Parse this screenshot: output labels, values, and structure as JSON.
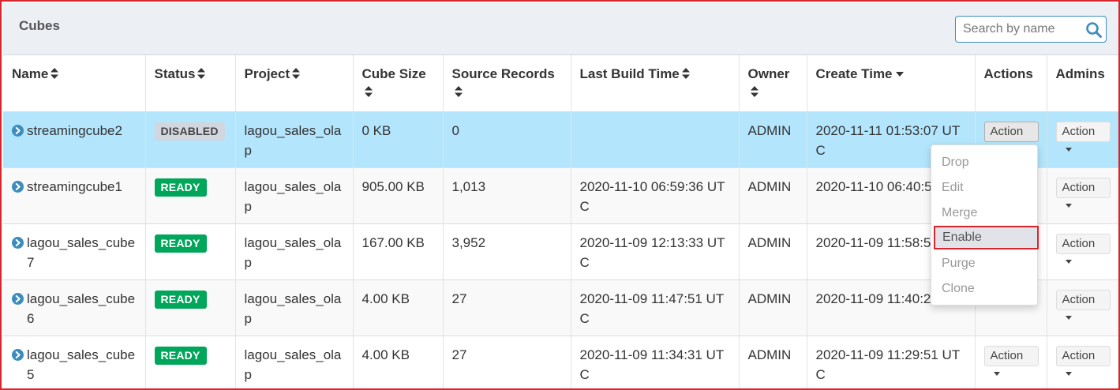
{
  "panel": {
    "title": "Cubes",
    "search_placeholder": "Search by name",
    "search_icon": "search-icon"
  },
  "colors": {
    "selected_row": "#b3e5fc",
    "ready_badge": "#00a65a",
    "disabled_badge": "#d2d6de",
    "highlight_border": "#d9262e",
    "link_icon": "#3c8dbc"
  },
  "columns": [
    {
      "label": "Name",
      "sort": "both"
    },
    {
      "label": "Status",
      "sort": "both"
    },
    {
      "label": "Project",
      "sort": "both"
    },
    {
      "label": "Cube Size",
      "sort": "both"
    },
    {
      "label": "Source Records",
      "sort": "both"
    },
    {
      "label": "Last Build Time",
      "sort": "both"
    },
    {
      "label": "Owner",
      "sort": "both"
    },
    {
      "label": "Create Time",
      "sort": "desc"
    },
    {
      "label": "Actions",
      "sort": "none"
    },
    {
      "label": "Admins",
      "sort": "none"
    }
  ],
  "rows": [
    {
      "name": "streamingcube2",
      "status": "DISABLED",
      "project": "lagou_sales_olap",
      "cube_size": "0 KB",
      "source_records": "0",
      "last_build_time": "",
      "owner": "ADMIN",
      "create_time": "2020-11-11 01:53:07 UTC",
      "action_label": "Action",
      "admin_label": "Action"
    },
    {
      "name": "streamingcube1",
      "status": "READY",
      "project": "lagou_sales_olap",
      "cube_size": "905.00 KB",
      "source_records": "1,013",
      "last_build_time": "2020-11-10 06:59:36 UTC",
      "owner": "ADMIN",
      "create_time": "2020-11-10 06:40:5",
      "action_label": "",
      "admin_label": "Action"
    },
    {
      "name": "lagou_sales_cube7",
      "status": "READY",
      "project": "lagou_sales_olap",
      "cube_size": "167.00 KB",
      "source_records": "3,952",
      "last_build_time": "2020-11-09 12:13:33 UTC",
      "owner": "ADMIN",
      "create_time": "2020-11-09 11:58:5",
      "action_label": "",
      "admin_label": "Action"
    },
    {
      "name": "lagou_sales_cube6",
      "status": "READY",
      "project": "lagou_sales_olap",
      "cube_size": "4.00 KB",
      "source_records": "27",
      "last_build_time": "2020-11-09 11:47:51 UTC",
      "owner": "ADMIN",
      "create_time": "2020-11-09 11:40:2",
      "action_label": "",
      "admin_label": "Action"
    },
    {
      "name": "lagou_sales_cube5",
      "status": "READY",
      "project": "lagou_sales_olap",
      "cube_size": "4.00 KB",
      "source_records": "27",
      "last_build_time": "2020-11-09 11:34:31 UTC",
      "owner": "ADMIN",
      "create_time": "2020-11-09 11:29:51 UTC",
      "action_label": "Action",
      "admin_label": "Action"
    }
  ],
  "dropdown": {
    "items": [
      "Drop",
      "Edit",
      "Merge",
      "Enable",
      "Purge",
      "Clone"
    ],
    "highlighted": "Enable"
  }
}
